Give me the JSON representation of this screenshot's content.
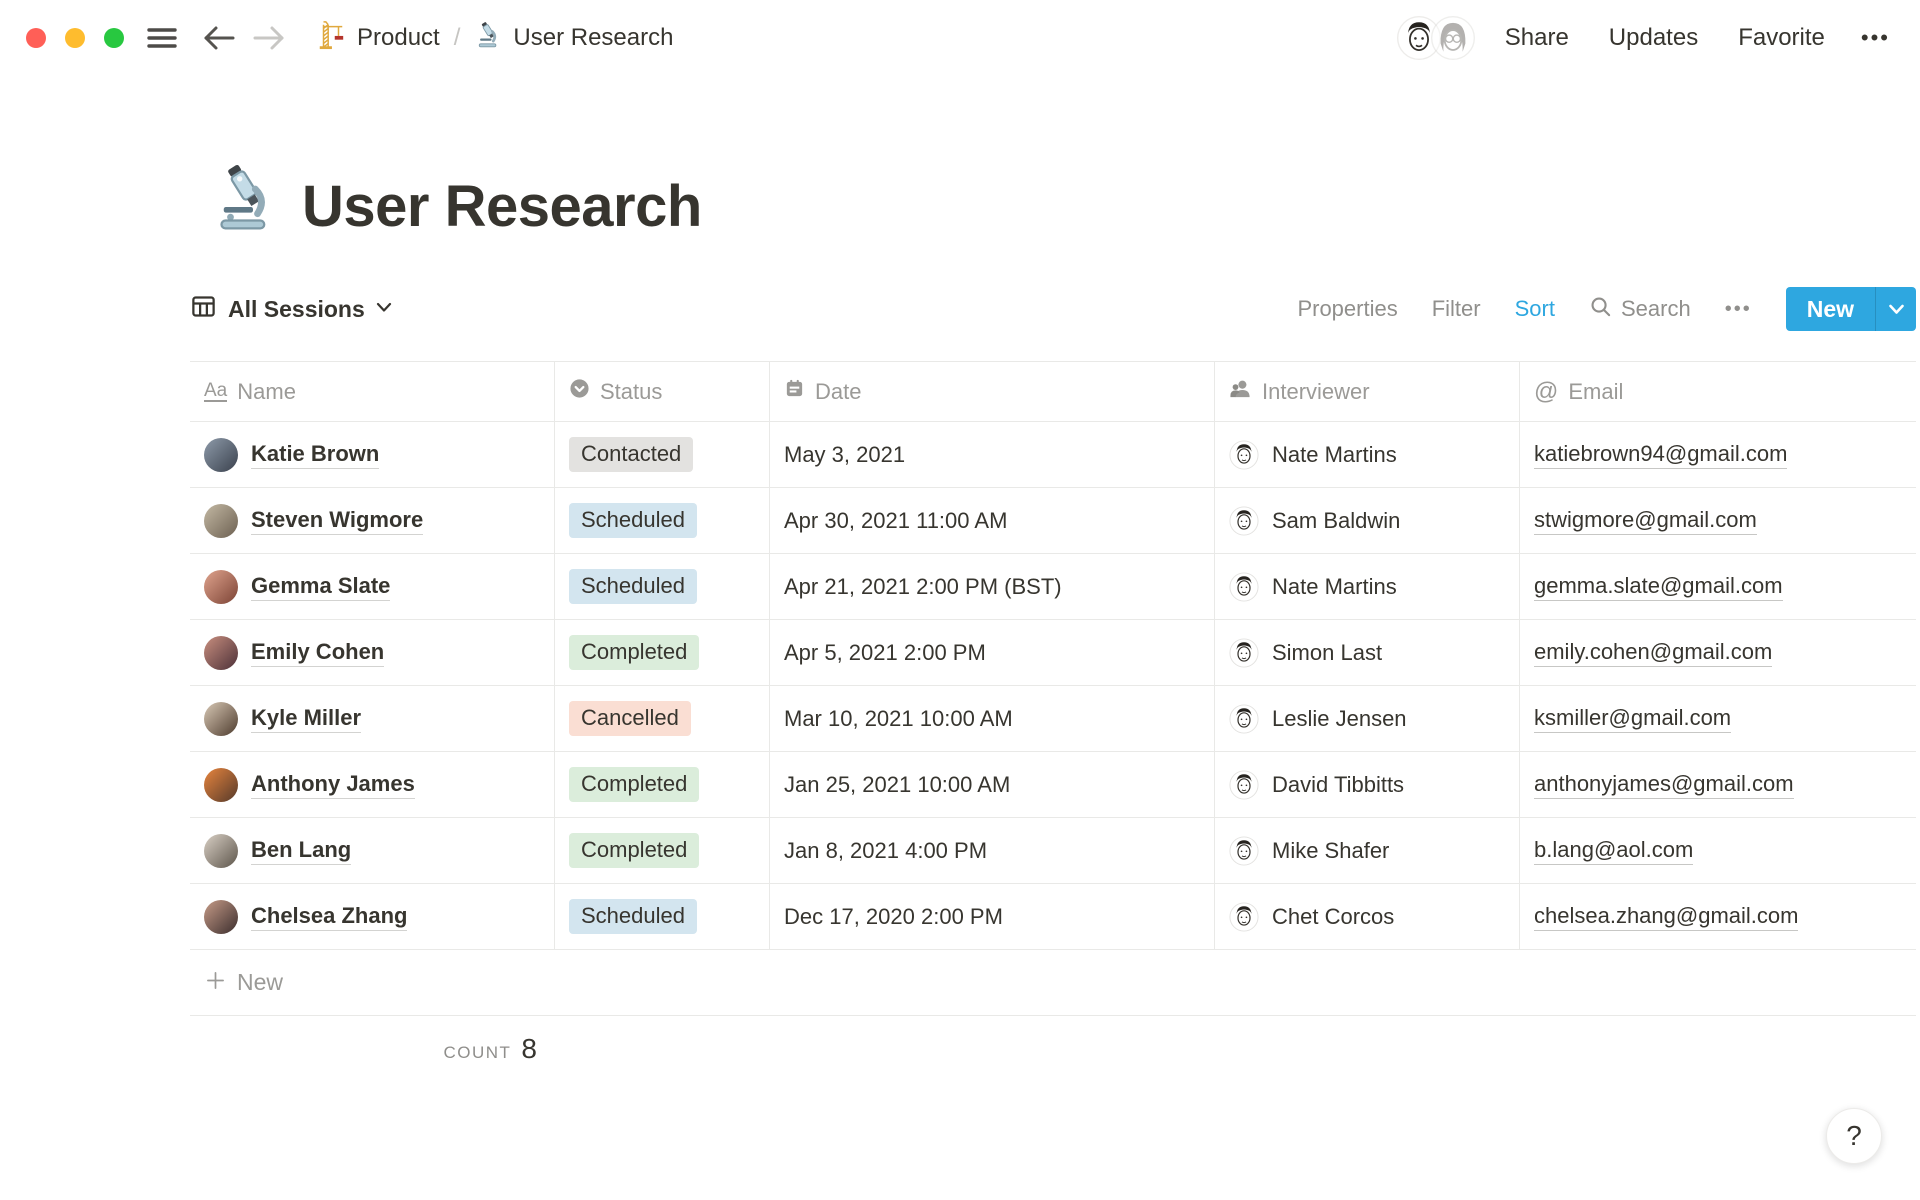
{
  "window": {
    "traffic_lights": [
      "#FF5F57",
      "#FEBC2E",
      "#28C840"
    ]
  },
  "topbar": {
    "breadcrumb": [
      {
        "icon": "crane-icon",
        "label": "Product"
      },
      {
        "icon": "microscope-icon",
        "label": "User Research"
      }
    ],
    "separator": "/",
    "actions": [
      "Share",
      "Updates",
      "Favorite"
    ],
    "more_label": "•••"
  },
  "page": {
    "icon": "microscope-icon",
    "title": "User Research"
  },
  "view_bar": {
    "view_name": "All Sessions",
    "menu": [
      {
        "label": "Properties",
        "active": false
      },
      {
        "label": "Filter",
        "active": false
      },
      {
        "label": "Sort",
        "active": true
      }
    ],
    "search_label": "Search",
    "more_label": "•••",
    "new_button_label": "New",
    "accent_color": "#2EA7E0"
  },
  "table": {
    "columns": [
      {
        "key": "name",
        "label": "Name",
        "icon": "text-icon"
      },
      {
        "key": "status",
        "label": "Status",
        "icon": "select-icon"
      },
      {
        "key": "date",
        "label": "Date",
        "icon": "calendar-icon"
      },
      {
        "key": "interviewer",
        "label": "Interviewer",
        "icon": "person-icon"
      },
      {
        "key": "email",
        "label": "Email",
        "icon": "at-icon"
      }
    ],
    "status_colors": {
      "Contacted": "#E3E2E0",
      "Scheduled": "#D3E5EF",
      "Completed": "#DBEDDB",
      "Cancelled": "#FADED3"
    },
    "rows": [
      {
        "name": "Katie Brown",
        "status": "Contacted",
        "date": "May 3, 2021",
        "interviewer": "Nate Martins",
        "email": "katiebrown94@gmail.com",
        "avatar_colors": [
          "#8E9BAA",
          "#3A414D"
        ]
      },
      {
        "name": "Steven Wigmore",
        "status": "Scheduled",
        "date": "Apr 30, 2021 11:00 AM",
        "interviewer": "Sam Baldwin",
        "email": "stwigmore@gmail.com",
        "avatar_colors": [
          "#C4B9A4",
          "#6C6051"
        ]
      },
      {
        "name": "Gemma Slate",
        "status": "Scheduled",
        "date": "Apr 21, 2021 2:00 PM (BST)",
        "interviewer": "Nate Martins",
        "email": "gemma.slate@gmail.com",
        "avatar_colors": [
          "#E0A48E",
          "#7C4335"
        ]
      },
      {
        "name": "Emily Cohen",
        "status": "Completed",
        "date": "Apr 5, 2021 2:00 PM",
        "interviewer": "Simon Last",
        "email": "emily.cohen@gmail.com",
        "avatar_colors": [
          "#C98F7F",
          "#4C3038"
        ]
      },
      {
        "name": "Kyle Miller",
        "status": "Cancelled",
        "date": "Mar 10, 2021 10:00 AM",
        "interviewer": "Leslie Jensen",
        "email": "ksmiller@gmail.com",
        "avatar_colors": [
          "#D9C9B6",
          "#4E3C2E"
        ]
      },
      {
        "name": "Anthony James",
        "status": "Completed",
        "date": "Jan 25, 2021 10:00 AM",
        "interviewer": "David Tibbitts",
        "email": "anthonyjames@gmail.com",
        "avatar_colors": [
          "#E8853E",
          "#55392A"
        ]
      },
      {
        "name": "Ben Lang",
        "status": "Completed",
        "date": "Jan 8, 2021 4:00 PM",
        "interviewer": "Mike Shafer",
        "email": "b.lang@aol.com",
        "avatar_colors": [
          "#D9D0C5",
          "#5D554B"
        ]
      },
      {
        "name": "Chelsea Zhang",
        "status": "Scheduled",
        "date": "Dec 17, 2020 2:00 PM",
        "interviewer": "Chet Corcos",
        "email": "chelsea.zhang@gmail.com",
        "avatar_colors": [
          "#C79C88",
          "#3B2D2D"
        ]
      }
    ],
    "new_row_label": "New",
    "count_label": "COUNT",
    "count_value": "8"
  },
  "help_button_label": "?"
}
